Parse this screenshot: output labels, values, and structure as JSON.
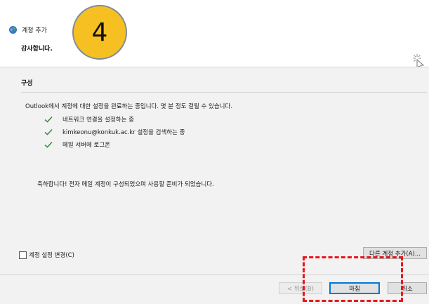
{
  "window": {
    "title": "계정 추가",
    "subtitle": "감사합니다."
  },
  "annotation": {
    "step_number": "4",
    "circle_color": "#f6c022",
    "highlight_color": "#e8141b"
  },
  "section": {
    "title": "구성"
  },
  "progress": {
    "intro": "Outlook에서 계정에 대한 설정을 완료하는 중입니다. 몇 분 정도 걸릴 수 있습니다.",
    "steps": [
      {
        "label": "네트워크 연결을 설정하는 중",
        "icon": "checkmark-icon",
        "status": "done"
      },
      {
        "label": "kimkeonu@konkuk.ac.kr 설정을 검색하는 중",
        "icon": "checkmark-icon",
        "status": "done"
      },
      {
        "label": "메일 서버에 로그온",
        "icon": "checkmark-icon",
        "status": "done"
      }
    ],
    "check_color": "#3e8e41",
    "congrats": "축하합니다! 전자 메일 계정이 구성되었으며 사용할 준비가 되었습니다."
  },
  "options": {
    "change_settings_label": "계정 설정 변경(C)",
    "change_settings_checked": false,
    "add_another_label": "다른 계정 추가(A)..."
  },
  "footer": {
    "back_label": "< 뒤로(B)",
    "back_enabled": false,
    "finish_label": "마침",
    "cancel_label": "취소",
    "accent_color": "#0078d7"
  }
}
